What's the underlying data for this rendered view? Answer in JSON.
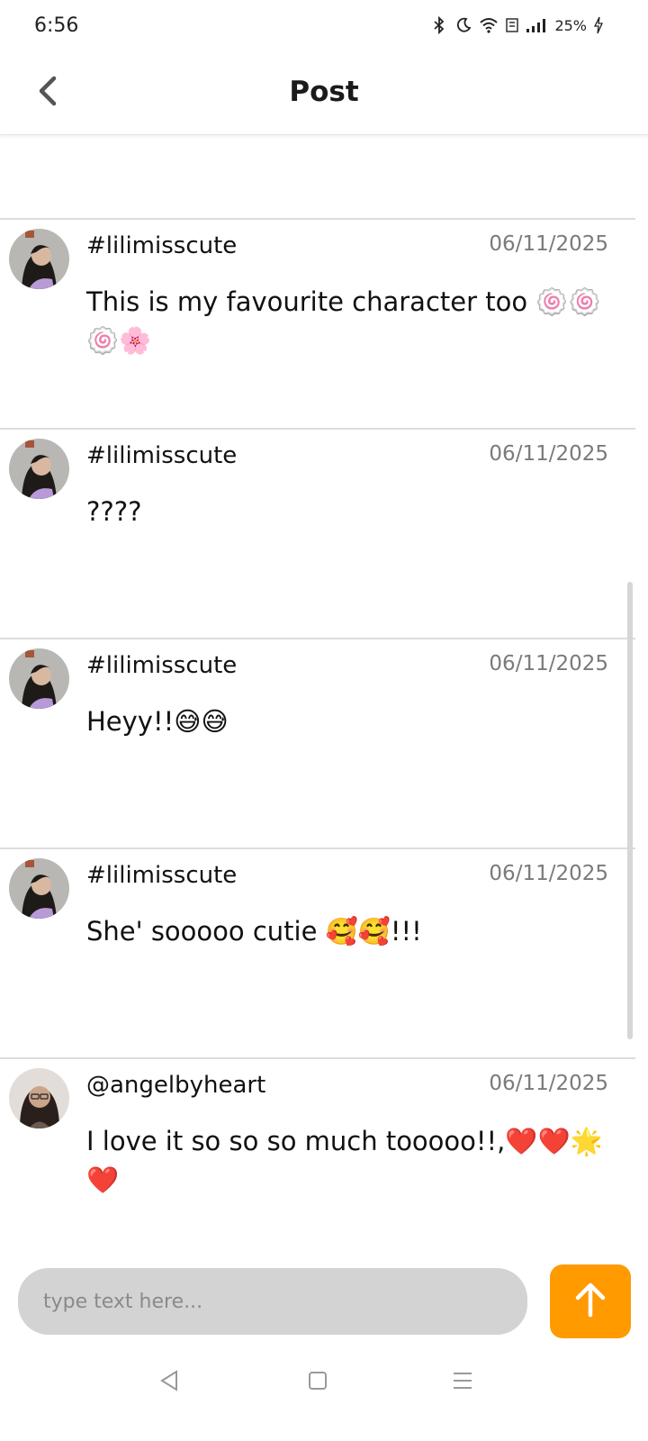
{
  "status_bar": {
    "time": "6:56",
    "battery": "25%"
  },
  "header": {
    "title": "Post"
  },
  "comments": [
    {
      "user": "#lilimisscute",
      "date": "06/11/2025",
      "text": "This is my favourite character too 🍥🍥🍥🌸"
    },
    {
      "user": "#lilimisscute",
      "date": "06/11/2025",
      "text": "????"
    },
    {
      "user": "#lilimisscute",
      "date": "06/11/2025",
      "text": "Heyy!!😅😅"
    },
    {
      "user": "#lilimisscute",
      "date": "06/11/2025",
      "text": "She' sooooo cutie 🥰🥰!!!"
    },
    {
      "user": "@angelbyheart",
      "date": "06/11/2025",
      "text": "I love it so so so much tooooo!!,❤️❤️🌟❤️"
    }
  ],
  "composer": {
    "placeholder": "type text here..."
  },
  "colors": {
    "accent": "#ff9a00",
    "input_bg": "#d3d3d3",
    "divider": "#dcdcdc"
  },
  "icons": {
    "back": "chevron-left-icon",
    "send": "arrow-up-icon",
    "nav_back": "triangle-back-icon",
    "nav_home": "square-home-icon",
    "nav_menu": "menu-lines-icon"
  }
}
